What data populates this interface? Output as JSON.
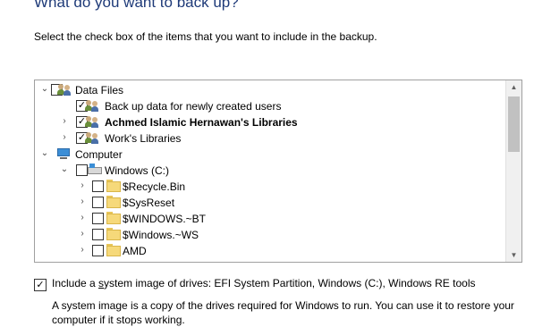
{
  "header": {
    "title": "What do you want to back up?",
    "instructions": "Select the check box of the items that you want to include in the backup."
  },
  "tree": {
    "data_files_label": "Data Files",
    "new_users_label": "Back up data for newly created users",
    "user_libraries_label": "Achmed Islamic Hernawan's Libraries",
    "work_libraries_label": "Work's Libraries",
    "computer_label": "Computer",
    "drive_label": "Windows (C:)",
    "folders": [
      "$Recycle.Bin",
      "$SysReset",
      "$WINDOWS.~BT",
      "$Windows.~WS",
      "AMD"
    ]
  },
  "system_image": {
    "label_prefix": "Include a ",
    "label_accel": "s",
    "label_suffix": "ystem image of drives: EFI System Partition, Windows (C:), Windows RE tools",
    "description": "A system image is a copy of the drives required for Windows to run. You can use it to restore your computer if it stops working."
  },
  "glyphs": {
    "check": "✓",
    "expanded": "⌄",
    "collapsed": "›",
    "scroll_up": "▲",
    "scroll_down": "▼"
  }
}
